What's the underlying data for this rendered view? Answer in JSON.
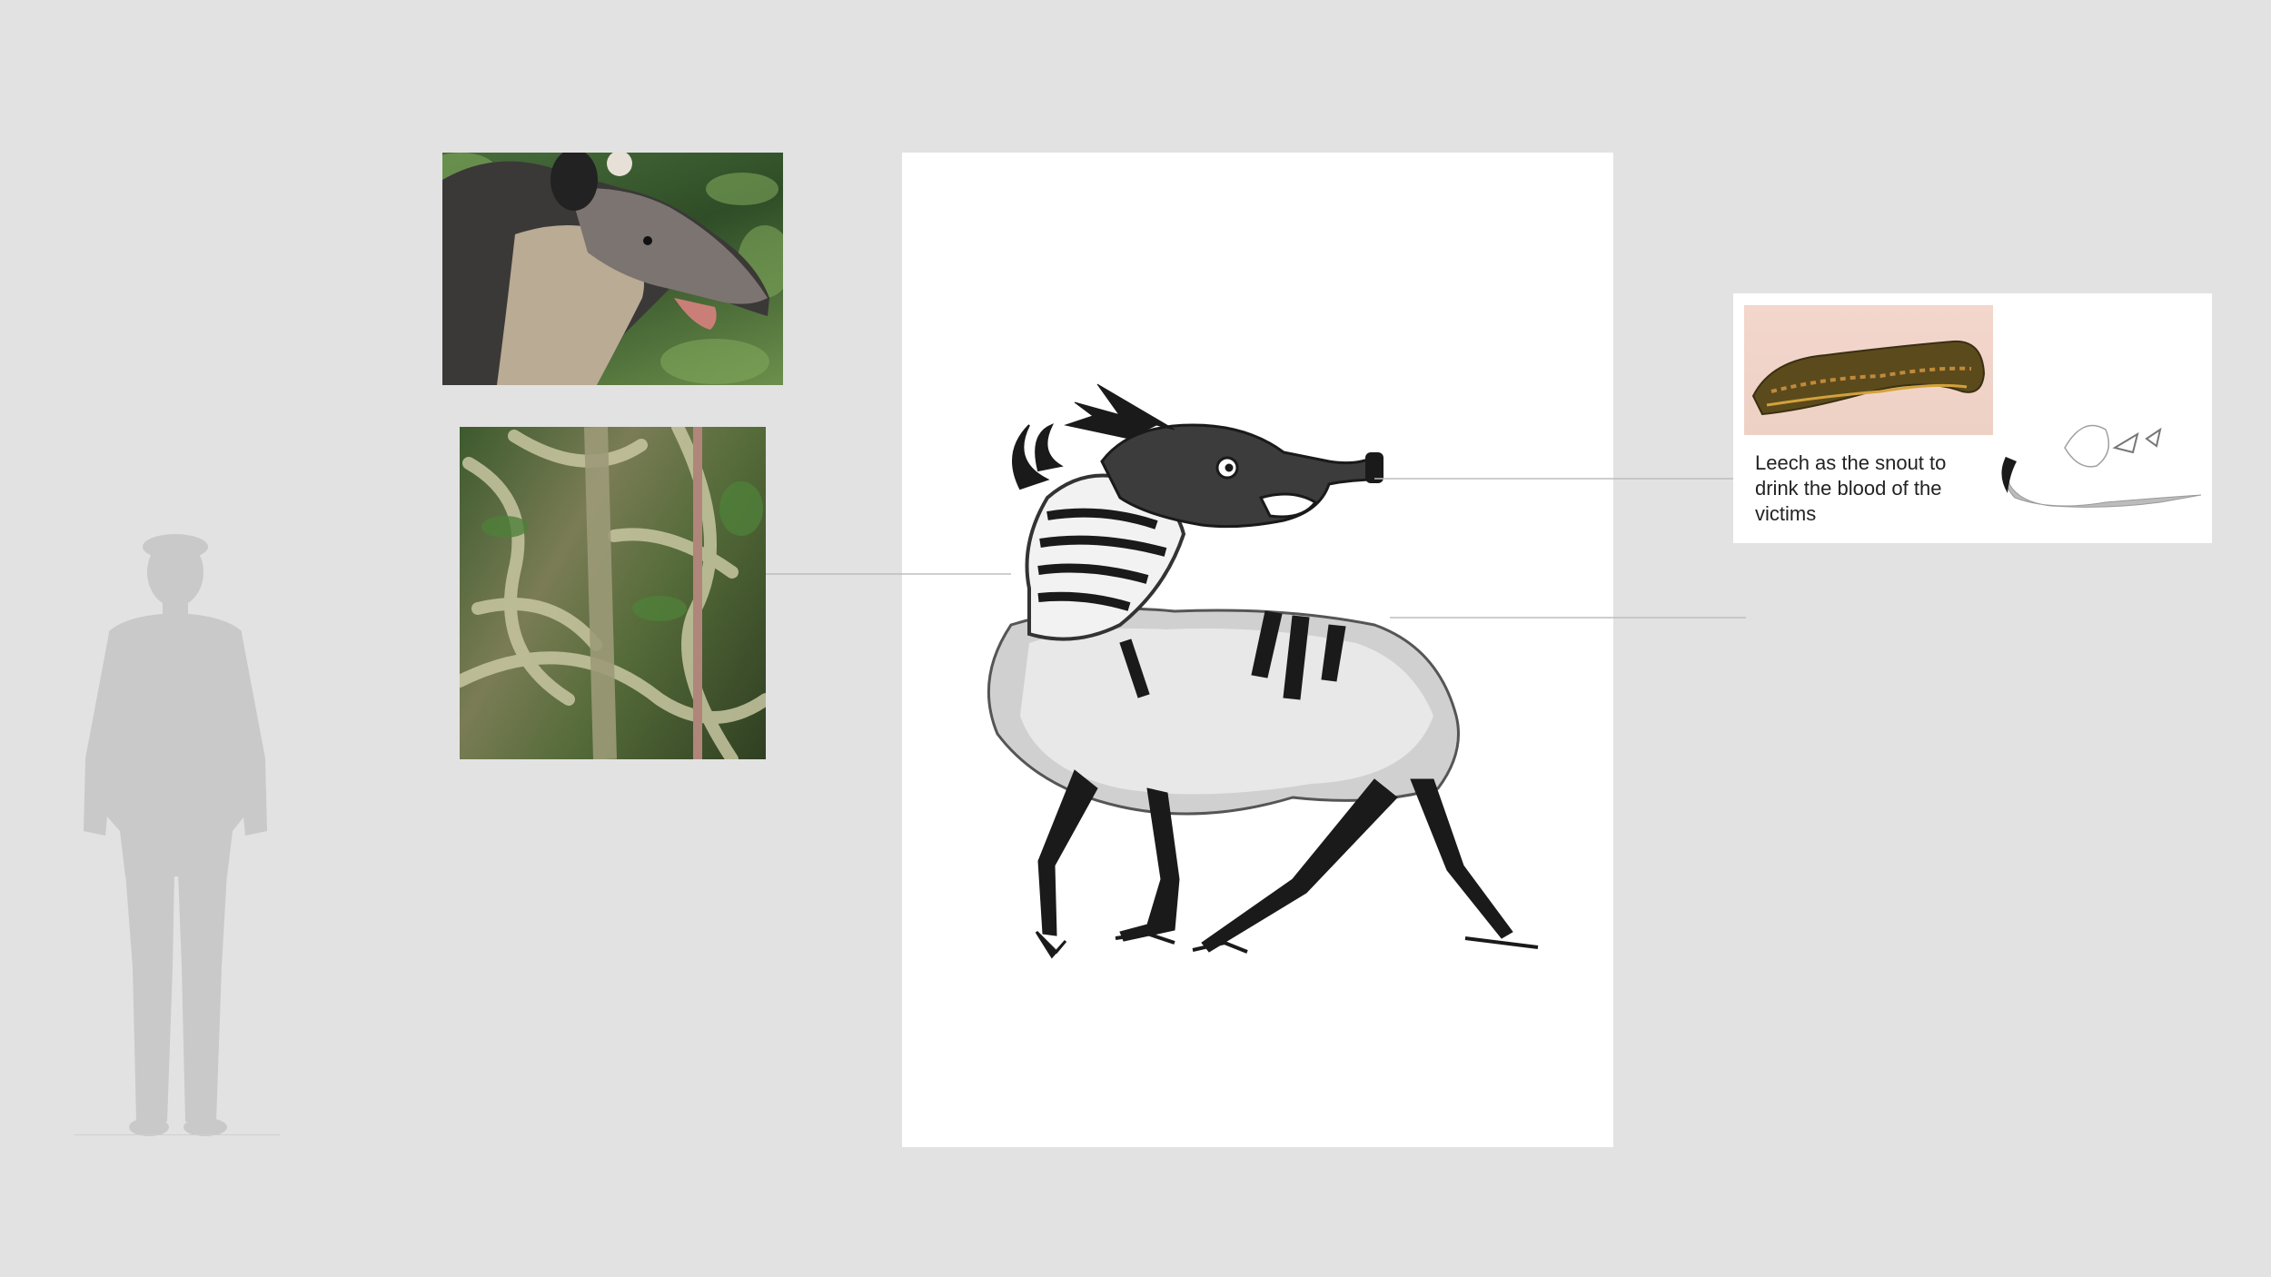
{
  "annotations": {
    "leech_caption": "Leech as the snout to drink the blood of the victims"
  },
  "images": {
    "tapir_photo": "tapir-photo",
    "vines_photo": "jungle-vines-photo",
    "creature_drawing": "creature-drawing",
    "leech_photo": "leech-photo",
    "leech_sketch": "leech-sketch",
    "human_scale": "human-silhouette"
  },
  "colors": {
    "background": "#e2e2e2",
    "canvas": "#ffffff",
    "silhouette": "#c9c9c9",
    "connector": "#bdbdbd",
    "ink": "#1a1a1a"
  }
}
